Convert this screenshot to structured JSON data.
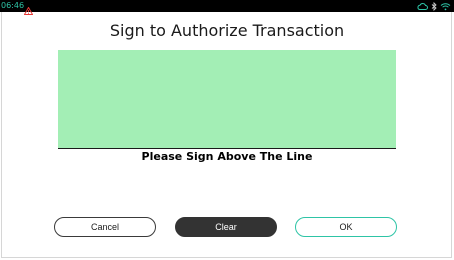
{
  "status_bar": {
    "time": "06:46",
    "icons": [
      "warning-icon",
      "cloud-icon",
      "bluetooth-icon",
      "wifi-icon"
    ],
    "accent_color": "#2ec4a6",
    "warning_color": "#e53935"
  },
  "screen": {
    "title": "Sign to Authorize Transaction",
    "instruction": "Please Sign Above The Line",
    "signature_pad_color": "#a3eeb5"
  },
  "actions": {
    "cancel_label": "Cancel",
    "clear_label": "Clear",
    "ok_label": "OK"
  }
}
